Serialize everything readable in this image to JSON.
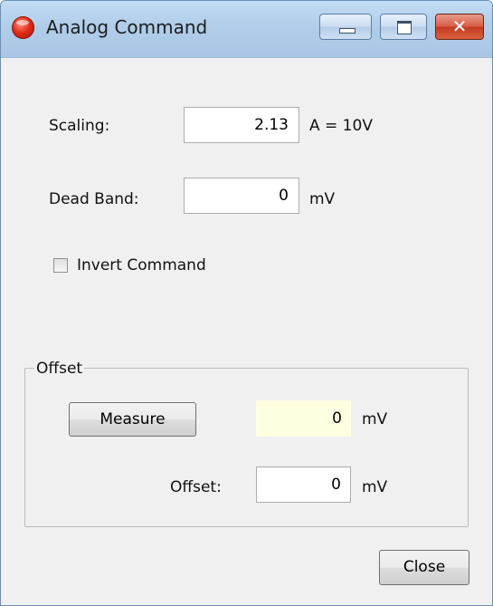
{
  "window": {
    "title": "Analog Command",
    "controls": {
      "minimize": "minimize",
      "maximize": "maximize",
      "close": "✕"
    }
  },
  "scaling": {
    "label": "Scaling:",
    "value": "2.13",
    "unit": "A = 10V"
  },
  "dead_band": {
    "label": "Dead Band:",
    "value": "0",
    "unit": "mV"
  },
  "invert_command": {
    "label": "Invert Command",
    "checked": false
  },
  "offset_group": {
    "legend": "Offset",
    "measure_button": "Measure",
    "measured_value": "0",
    "measured_unit": "mV",
    "offset_label": "Offset:",
    "offset_value": "0",
    "offset_unit": "mV"
  },
  "footer": {
    "close_button": "Close"
  },
  "colors": {
    "titlebar": "#b0cde9",
    "window_bg": "#f0f0f0",
    "readout_bg": "#ffffe1",
    "close_button": "#c23a22"
  },
  "icons": {
    "app": "app-red-sphere-icon",
    "minimize": "minimize-icon",
    "maximize": "maximize-icon",
    "close": "close-icon"
  }
}
